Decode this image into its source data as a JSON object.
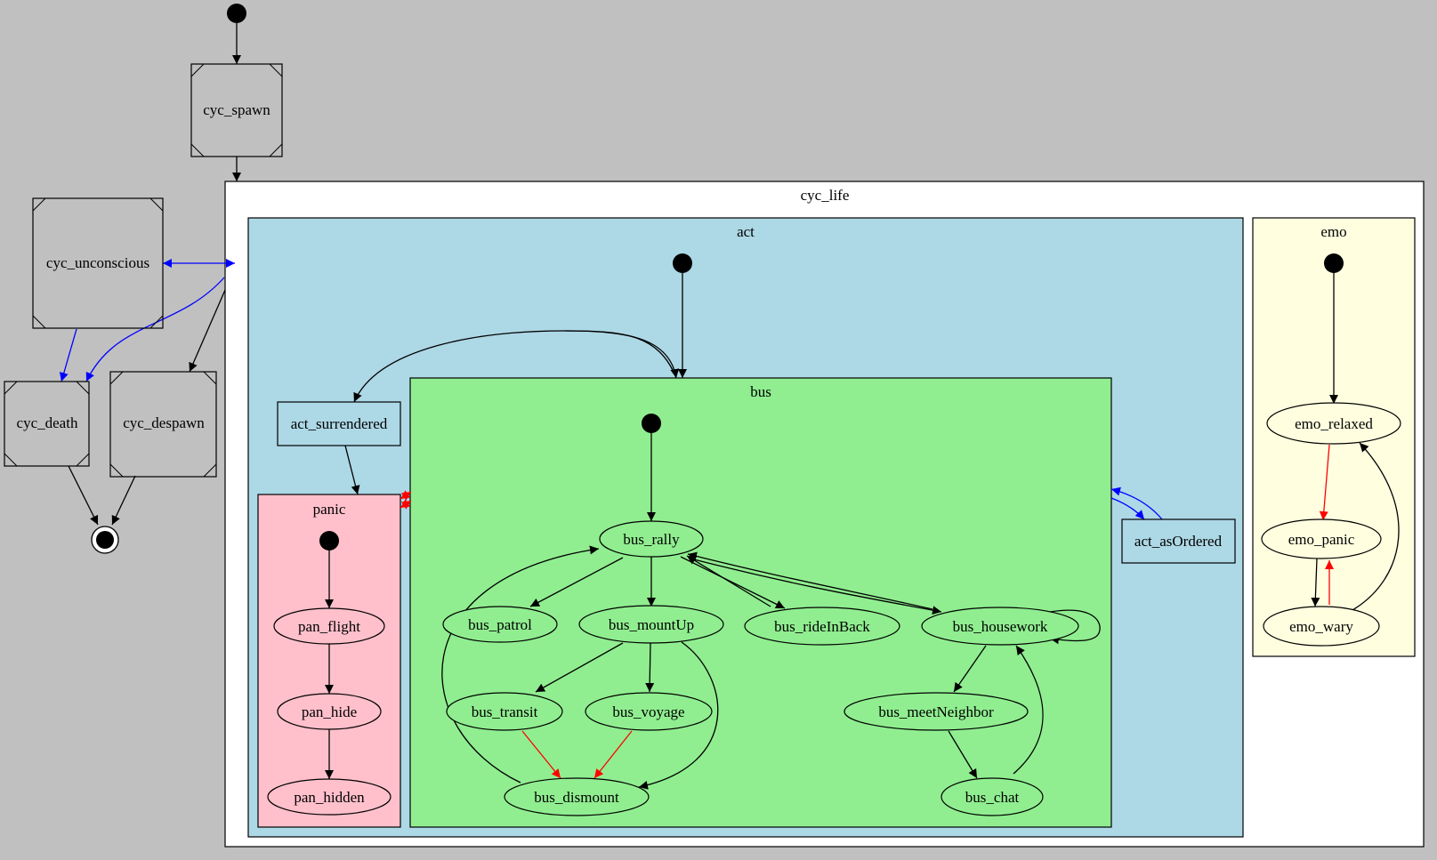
{
  "colors": {
    "background": "#c0c0c0",
    "cyc_life_fill": "#ffffff",
    "act_fill": "#add8e6",
    "bus_fill": "#90ee90",
    "panic_fill": "#ffc0cb",
    "emo_fill": "#ffffe0",
    "edge_default": "#000000",
    "edge_red": "#ff0000",
    "edge_blue": "#0000ff"
  },
  "clusters": {
    "cyc_life": "cyc_life",
    "act": "act",
    "bus": "bus",
    "panic": "panic",
    "emo": "emo"
  },
  "states": {
    "cyc_spawn": "cyc_spawn",
    "cyc_unconscious": "cyc_unconscious",
    "cyc_death": "cyc_death",
    "cyc_despawn": "cyc_despawn",
    "act_surrendered": "act_surrendered",
    "act_asOrdered": "act_asOrdered",
    "pan_flight": "pan_flight",
    "pan_hide": "pan_hide",
    "pan_hidden": "pan_hidden",
    "bus_rally": "bus_rally",
    "bus_patrol": "bus_patrol",
    "bus_mountUp": "bus_mountUp",
    "bus_rideInBack": "bus_rideInBack",
    "bus_housework": "bus_housework",
    "bus_transit": "bus_transit",
    "bus_voyage": "bus_voyage",
    "bus_meetNeighbor": "bus_meetNeighbor",
    "bus_dismount": "bus_dismount",
    "bus_chat": "bus_chat",
    "emo_relaxed": "emo_relaxed",
    "emo_panic": "emo_panic",
    "emo_wary": "emo_wary"
  },
  "transitions": [
    {
      "from": "initial",
      "to": "cyc_spawn",
      "color": "black"
    },
    {
      "from": "cyc_spawn",
      "to": "cyc_life",
      "color": "black"
    },
    {
      "from": "cyc_life",
      "to": "cyc_unconscious",
      "color": "blue"
    },
    {
      "from": "cyc_unconscious",
      "to": "cyc_life",
      "color": "blue"
    },
    {
      "from": "cyc_unconscious",
      "to": "cyc_death",
      "color": "blue"
    },
    {
      "from": "cyc_life",
      "to": "cyc_death",
      "color": "blue"
    },
    {
      "from": "cyc_life",
      "to": "cyc_despawn",
      "color": "black"
    },
    {
      "from": "cyc_death",
      "to": "final",
      "color": "black"
    },
    {
      "from": "cyc_despawn",
      "to": "final",
      "color": "black"
    },
    {
      "from": "act.initial",
      "to": "bus",
      "color": "black"
    },
    {
      "from": "bus",
      "to": "act_surrendered",
      "color": "black"
    },
    {
      "from": "act_surrendered",
      "to": "bus",
      "color": "black"
    },
    {
      "from": "act_surrendered",
      "to": "panic",
      "color": "black"
    },
    {
      "from": "panic",
      "to": "bus",
      "color": "red"
    },
    {
      "from": "bus",
      "to": "panic",
      "color": "red"
    },
    {
      "from": "bus",
      "to": "act_asOrdered",
      "color": "blue"
    },
    {
      "from": "act_asOrdered",
      "to": "bus",
      "color": "blue"
    },
    {
      "from": "panic.initial",
      "to": "pan_flight",
      "color": "black"
    },
    {
      "from": "pan_flight",
      "to": "pan_hide",
      "color": "black"
    },
    {
      "from": "pan_hide",
      "to": "pan_hidden",
      "color": "black"
    },
    {
      "from": "bus.initial",
      "to": "bus_rally",
      "color": "black"
    },
    {
      "from": "bus_rally",
      "to": "bus_patrol",
      "color": "black"
    },
    {
      "from": "bus_rally",
      "to": "bus_mountUp",
      "color": "black"
    },
    {
      "from": "bus_rally",
      "to": "bus_rideInBack",
      "color": "black"
    },
    {
      "from": "bus_rideInBack",
      "to": "bus_rally",
      "color": "black"
    },
    {
      "from": "bus_rally",
      "to": "bus_housework",
      "color": "black"
    },
    {
      "from": "bus_housework",
      "to": "bus_rally",
      "color": "black"
    },
    {
      "from": "bus_housework",
      "to": "bus_housework",
      "color": "black"
    },
    {
      "from": "bus_mountUp",
      "to": "bus_transit",
      "color": "black"
    },
    {
      "from": "bus_mountUp",
      "to": "bus_voyage",
      "color": "black"
    },
    {
      "from": "bus_mountUp",
      "to": "bus_dismount",
      "color": "black"
    },
    {
      "from": "bus_transit",
      "to": "bus_dismount",
      "color": "red"
    },
    {
      "from": "bus_voyage",
      "to": "bus_dismount",
      "color": "red"
    },
    {
      "from": "bus_dismount",
      "to": "bus_rally",
      "color": "black"
    },
    {
      "from": "bus_housework",
      "to": "bus_meetNeighbor",
      "color": "black"
    },
    {
      "from": "bus_meetNeighbor",
      "to": "bus_chat",
      "color": "black"
    },
    {
      "from": "bus_chat",
      "to": "bus_housework",
      "color": "black"
    },
    {
      "from": "emo.initial",
      "to": "emo_relaxed",
      "color": "black"
    },
    {
      "from": "emo_relaxed",
      "to": "emo_panic",
      "color": "red"
    },
    {
      "from": "emo_panic",
      "to": "emo_wary",
      "color": "black"
    },
    {
      "from": "emo_wary",
      "to": "emo_panic",
      "color": "red"
    },
    {
      "from": "emo_wary",
      "to": "emo_relaxed",
      "color": "black"
    }
  ]
}
